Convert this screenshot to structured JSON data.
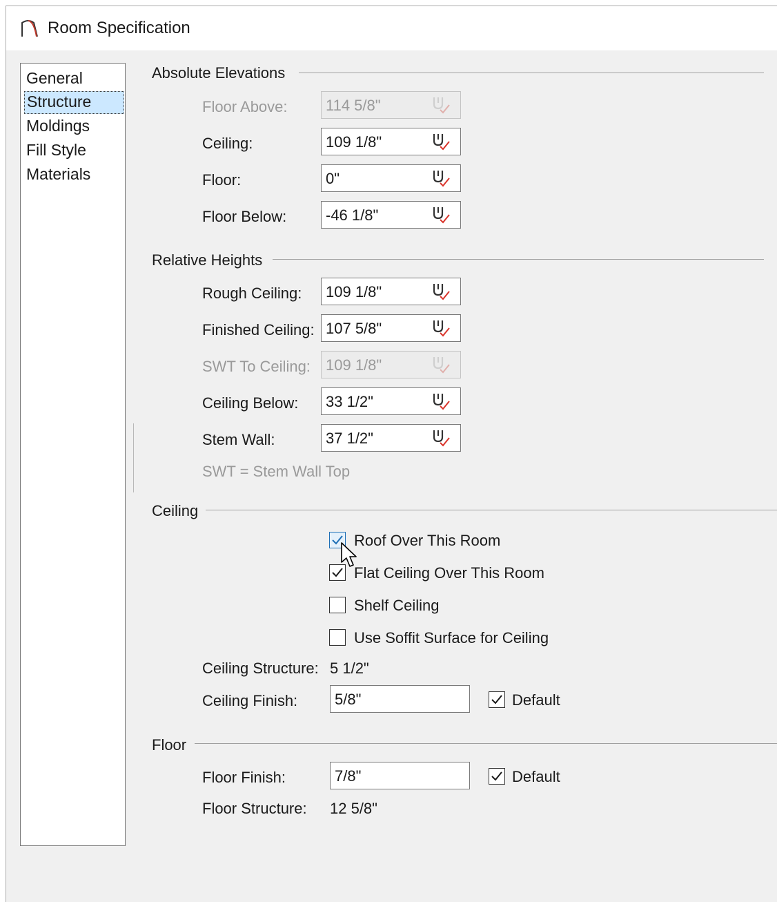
{
  "window": {
    "title": "Room Specification"
  },
  "nav": {
    "items": [
      "General",
      "Structure",
      "Moldings",
      "Fill Style",
      "Materials"
    ],
    "selected": "Structure"
  },
  "absolute_elevations": {
    "title": "Absolute Elevations",
    "fields": [
      {
        "label": "Floor Above:",
        "value": "114 5/8\"",
        "disabled": true
      },
      {
        "label": "Ceiling:",
        "value": "109 1/8\"",
        "disabled": false
      },
      {
        "label": "Floor:",
        "value": "0\"",
        "disabled": false
      },
      {
        "label": "Floor Below:",
        "value": "-46 1/8\"",
        "disabled": false
      }
    ]
  },
  "relative_heights": {
    "title": "Relative Heights",
    "fields": [
      {
        "label": "Rough Ceiling:",
        "value": "109 1/8\"",
        "disabled": false
      },
      {
        "label": "Finished Ceiling:",
        "value": "107 5/8\"",
        "disabled": false
      },
      {
        "label": "SWT To Ceiling:",
        "value": "109 1/8\"",
        "disabled": true
      },
      {
        "label": "Ceiling Below:",
        "value": "33 1/2\"",
        "disabled": false
      },
      {
        "label": "Stem Wall:",
        "value": "37 1/2\"",
        "disabled": false
      }
    ],
    "note": "SWT = Stem Wall Top"
  },
  "ceiling": {
    "title": "Ceiling",
    "checkboxes": [
      {
        "label": "Roof Over This Room",
        "checked": true
      },
      {
        "label": "Flat Ceiling Over This Room",
        "checked": true
      },
      {
        "label": "Shelf Ceiling",
        "checked": false
      },
      {
        "label": "Use Soffit Surface for Ceiling",
        "checked": false
      }
    ],
    "structure_label": "Ceiling Structure:",
    "structure_value": "5 1/2\"",
    "finish_label": "Ceiling Finish:",
    "finish_value": "5/8\"",
    "finish_default_label": "Default",
    "finish_default_checked": true
  },
  "floor": {
    "title": "Floor",
    "finish_label": "Floor Finish:",
    "finish_value": "7/8\"",
    "finish_default_label": "Default",
    "finish_default_checked": true,
    "structure_label": "Floor Structure:",
    "structure_value": "12 5/8\""
  },
  "colors": {
    "accent": "#cce8ff",
    "reference_check": "#d9342b",
    "hover_border": "#1e6fb6"
  },
  "icons": {
    "reference": "reference-marker-icon",
    "app": "room-arch-icon"
  }
}
